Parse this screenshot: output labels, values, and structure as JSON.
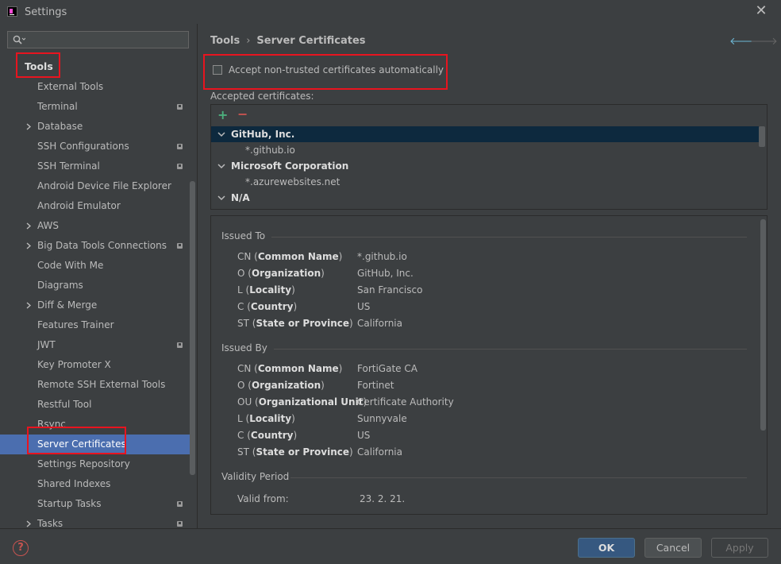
{
  "window": {
    "title": "Settings"
  },
  "search": {
    "value": "",
    "placeholder": ""
  },
  "sidebar": {
    "root": "Tools",
    "items": [
      {
        "label": "External Tools",
        "chevron": false,
        "badge": false,
        "selected": false
      },
      {
        "label": "Terminal",
        "chevron": false,
        "badge": true,
        "selected": false
      },
      {
        "label": "Database",
        "chevron": true,
        "badge": false,
        "selected": false
      },
      {
        "label": "SSH Configurations",
        "chevron": false,
        "badge": true,
        "selected": false
      },
      {
        "label": "SSH Terminal",
        "chevron": false,
        "badge": true,
        "selected": false
      },
      {
        "label": "Android Device File Explorer",
        "chevron": false,
        "badge": false,
        "selected": false
      },
      {
        "label": "Android Emulator",
        "chevron": false,
        "badge": false,
        "selected": false
      },
      {
        "label": "AWS",
        "chevron": true,
        "badge": false,
        "selected": false
      },
      {
        "label": "Big Data Tools Connections",
        "chevron": true,
        "badge": true,
        "selected": false
      },
      {
        "label": "Code With Me",
        "chevron": false,
        "badge": false,
        "selected": false
      },
      {
        "label": "Diagrams",
        "chevron": false,
        "badge": false,
        "selected": false
      },
      {
        "label": "Diff & Merge",
        "chevron": true,
        "badge": false,
        "selected": false
      },
      {
        "label": "Features Trainer",
        "chevron": false,
        "badge": false,
        "selected": false
      },
      {
        "label": "JWT",
        "chevron": false,
        "badge": true,
        "selected": false
      },
      {
        "label": "Key Promoter X",
        "chevron": false,
        "badge": false,
        "selected": false
      },
      {
        "label": "Remote SSH External Tools",
        "chevron": false,
        "badge": false,
        "selected": false
      },
      {
        "label": "Restful Tool",
        "chevron": false,
        "badge": false,
        "selected": false
      },
      {
        "label": "Rsync",
        "chevron": false,
        "badge": false,
        "selected": false
      },
      {
        "label": "Server Certificates",
        "chevron": false,
        "badge": false,
        "selected": true
      },
      {
        "label": "Settings Repository",
        "chevron": false,
        "badge": false,
        "selected": false
      },
      {
        "label": "Shared Indexes",
        "chevron": false,
        "badge": false,
        "selected": false
      },
      {
        "label": "Startup Tasks",
        "chevron": false,
        "badge": true,
        "selected": false
      },
      {
        "label": "Tasks",
        "chevron": true,
        "badge": true,
        "selected": false
      }
    ]
  },
  "breadcrumb": {
    "parent": "Tools",
    "current": "Server Certificates"
  },
  "options": {
    "accept_untrusted": "Accept non-trusted certificates automatically",
    "accept_untrusted_checked": false
  },
  "certificates": {
    "label": "Accepted certificates:",
    "add": "+",
    "remove": "−",
    "rows": [
      {
        "text": "GitHub, Inc.",
        "group": true,
        "selected": true
      },
      {
        "text": "*.github.io",
        "group": false,
        "selected": false
      },
      {
        "text": "Microsoft Corporation",
        "group": true,
        "selected": false
      },
      {
        "text": "*.azurewebsites.net",
        "group": false,
        "selected": false
      },
      {
        "text": "N/A",
        "group": true,
        "selected": false
      }
    ]
  },
  "details": {
    "issued_to": {
      "title": "Issued To",
      "fields": [
        {
          "abbr": "CN",
          "name": "Common Name",
          "value": "*.github.io"
        },
        {
          "abbr": "O",
          "name": "Organization",
          "value": "GitHub, Inc."
        },
        {
          "abbr": "L",
          "name": "Locality",
          "value": "San Francisco"
        },
        {
          "abbr": "C",
          "name": "Country",
          "value": "US"
        },
        {
          "abbr": "ST",
          "name": "State or Province",
          "value": "California"
        }
      ]
    },
    "issued_by": {
      "title": "Issued By",
      "fields": [
        {
          "abbr": "CN",
          "name": "Common Name",
          "value": "FortiGate CA"
        },
        {
          "abbr": "O",
          "name": "Organization",
          "value": "Fortinet"
        },
        {
          "abbr": "OU",
          "name": "Organizational Unit",
          "value": "Certificate Authority"
        },
        {
          "abbr": "L",
          "name": "Locality",
          "value": "Sunnyvale"
        },
        {
          "abbr": "C",
          "name": "Country",
          "value": "US"
        },
        {
          "abbr": "ST",
          "name": "State or Province",
          "value": "California"
        }
      ]
    },
    "validity": {
      "title": "Validity Period",
      "valid_from_label": "Valid from:",
      "valid_from": "23. 2. 21."
    }
  },
  "footer": {
    "help": "?",
    "ok": "OK",
    "cancel": "Cancel",
    "apply": "Apply"
  },
  "colors": {
    "background": "#3c3f41",
    "selection": "#4b6eaf",
    "list_selection": "#0d293e",
    "highlight_box": "#e8141f",
    "ok_button": "#365880"
  }
}
